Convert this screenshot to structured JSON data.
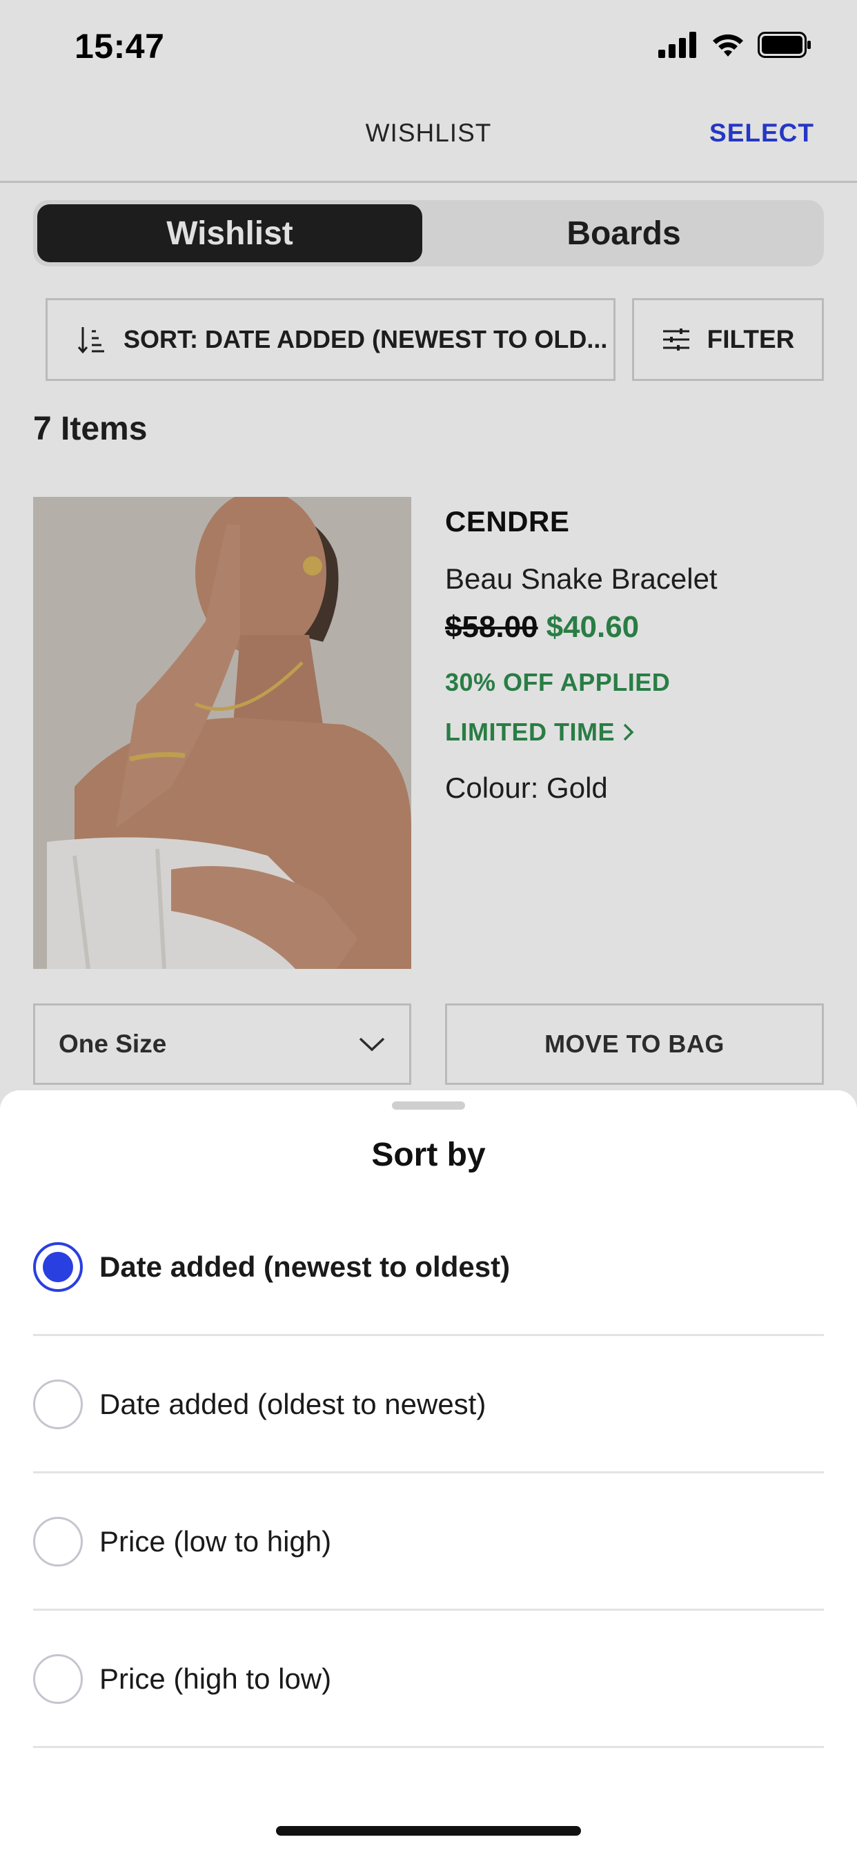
{
  "status_bar": {
    "time": "15:47"
  },
  "nav": {
    "title": "WISHLIST",
    "select_label": "SELECT"
  },
  "segments": {
    "wishlist": "Wishlist",
    "boards": "Boards"
  },
  "toolbar": {
    "sort_label": "SORT: DATE ADDED (NEWEST TO OLD...",
    "filter_label": "FILTER"
  },
  "items_count": "7 Items",
  "product": {
    "brand": "CENDRE",
    "name": "Beau Snake Bracelet",
    "old_price": "$58.00",
    "new_price": "$40.60",
    "discount": "30% OFF APPLIED",
    "limited": "LIMITED TIME",
    "colour": "Colour: Gold",
    "size": "One Size",
    "move_to_bag": "MOVE TO BAG"
  },
  "sort_sheet": {
    "title": "Sort by",
    "options": [
      {
        "label": "Date added (newest to oldest)",
        "selected": true
      },
      {
        "label": "Date added (oldest to newest)",
        "selected": false
      },
      {
        "label": "Price (low to high)",
        "selected": false
      },
      {
        "label": "Price (high to low)",
        "selected": false
      }
    ]
  },
  "colors": {
    "accent": "#2a3fe0",
    "sale": "#2f8f4e",
    "segment_active": "#222222"
  }
}
